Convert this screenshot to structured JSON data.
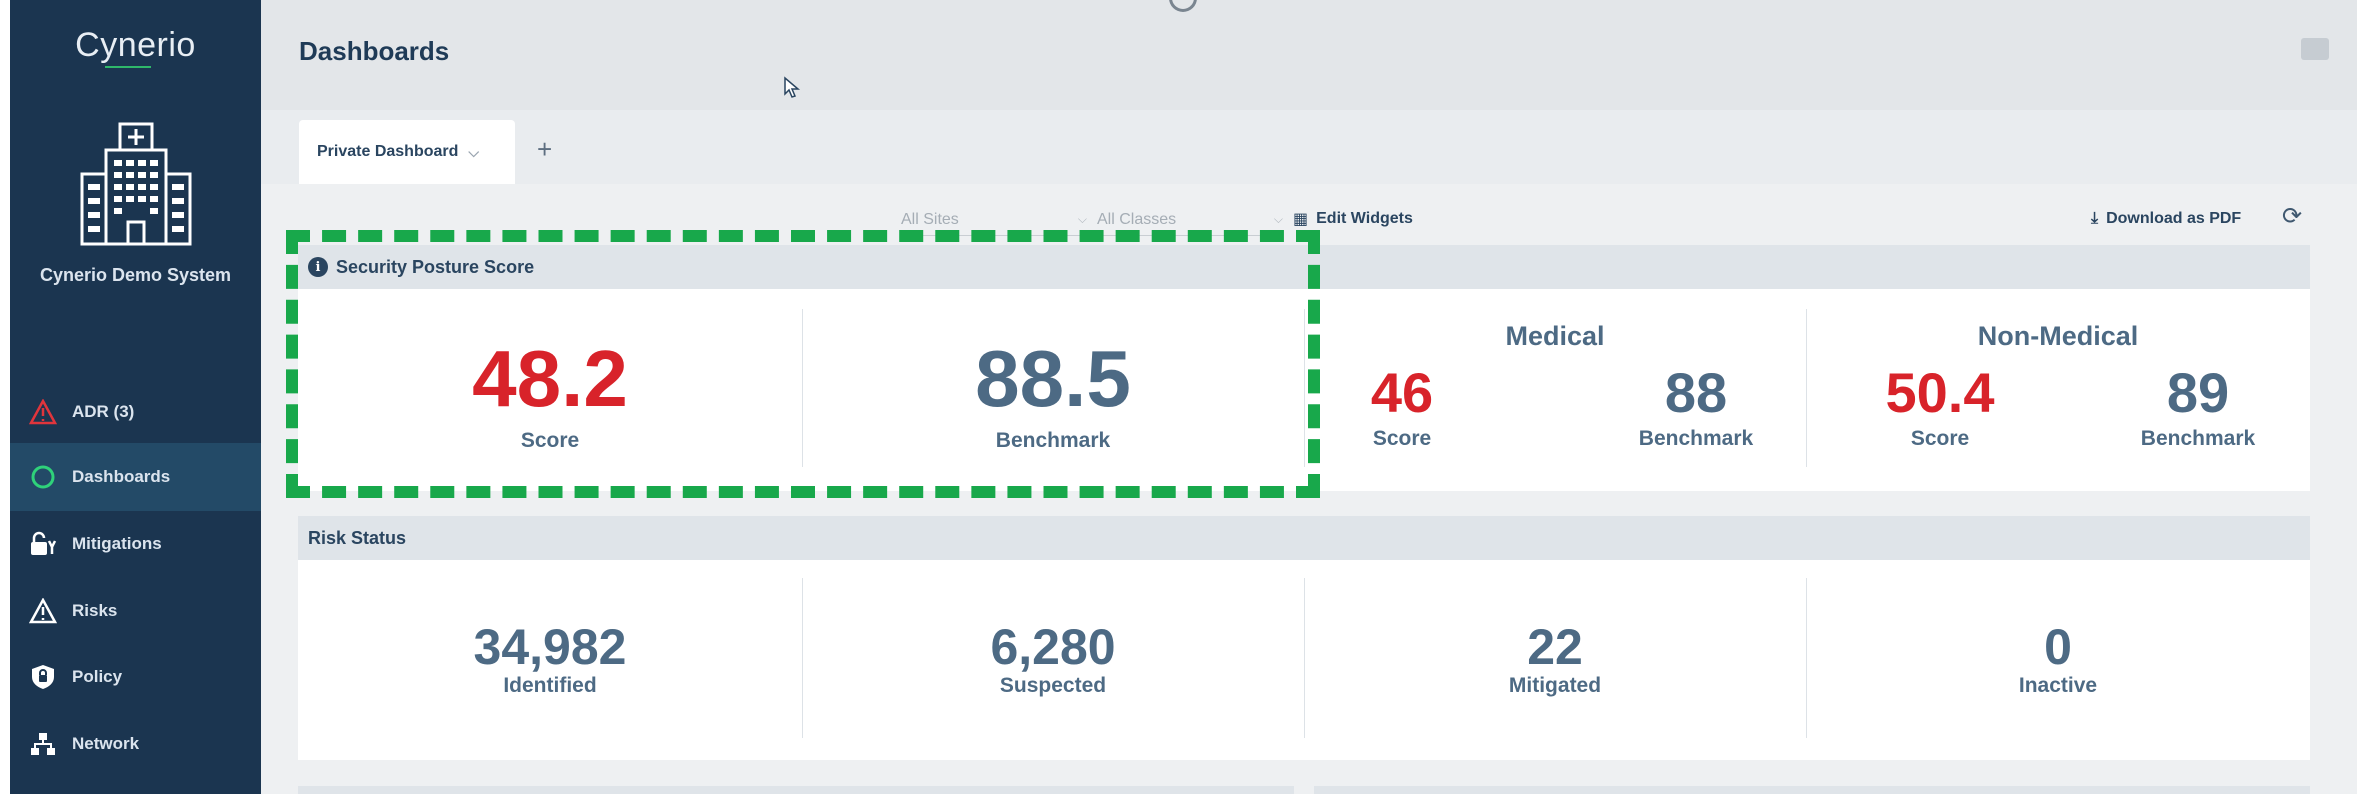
{
  "sidebar": {
    "logo": "Cynerio",
    "org_name": "Cynerio Demo System",
    "items": [
      {
        "label": "ADR (3)",
        "icon": "alert-triangle-icon"
      },
      {
        "label": "Dashboards",
        "icon": "circle-icon",
        "active": true
      },
      {
        "label": "Mitigations",
        "icon": "lock-icon"
      },
      {
        "label": "Risks",
        "icon": "warning-icon"
      },
      {
        "label": "Policy",
        "icon": "shield-icon"
      },
      {
        "label": "Network",
        "icon": "network-icon"
      }
    ]
  },
  "header": {
    "title": "Dashboards"
  },
  "tabs": [
    {
      "label": "Private Dashboard"
    }
  ],
  "add_tab_label": "+",
  "filters": {
    "sites": "All Sites",
    "classes": "All Classes"
  },
  "actions": {
    "edit_widgets": "Edit Widgets",
    "download_pdf": "Download as PDF"
  },
  "security_posture": {
    "title": "Security Posture Score",
    "overall": {
      "score": "48.2",
      "score_label": "Score",
      "benchmark": "88.5",
      "benchmark_label": "Benchmark"
    },
    "medical": {
      "title": "Medical",
      "score": "46",
      "score_label": "Score",
      "benchmark": "88",
      "benchmark_label": "Benchmark"
    },
    "non_medical": {
      "title": "Non-Medical",
      "score": "50.4",
      "score_label": "Score",
      "benchmark": "89",
      "benchmark_label": "Benchmark"
    }
  },
  "risk_status": {
    "title": "Risk Status",
    "items": [
      {
        "value": "34,982",
        "label": "Identified"
      },
      {
        "value": "6,280",
        "label": "Suspected"
      },
      {
        "value": "22",
        "label": "Mitigated"
      },
      {
        "value": "0",
        "label": "Inactive"
      }
    ]
  },
  "colors": {
    "sidebar": "#1b3550",
    "score_red": "#d8232a",
    "benchmark_blue": "#4d6a84",
    "highlight_green": "#18a84b"
  }
}
